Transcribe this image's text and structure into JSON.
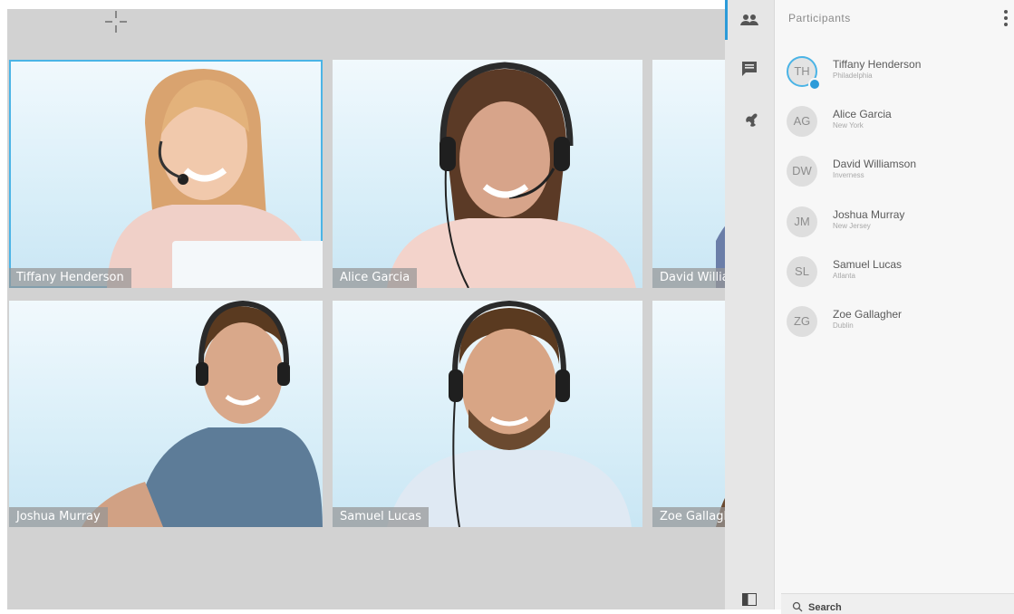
{
  "tiles": [
    {
      "name": "Tiffany Henderson",
      "active": true
    },
    {
      "name": "Alice Garcia"
    },
    {
      "name": "David Williamson"
    },
    {
      "name": "Joshua Murray"
    },
    {
      "name": "Samuel Lucas"
    },
    {
      "name": "Zoe Gallagher"
    }
  ],
  "panel": {
    "title": "Participants",
    "participants": [
      {
        "initials": "TH",
        "name": "Tiffany Henderson",
        "location": "Philadelphia"
      },
      {
        "initials": "AG",
        "name": "Alice Garcia",
        "location": "New York"
      },
      {
        "initials": "DW",
        "name": "David Williamson",
        "location": "Inverness"
      },
      {
        "initials": "JM",
        "name": "Joshua Murray",
        "location": "New Jersey"
      },
      {
        "initials": "SL",
        "name": "Samuel Lucas",
        "location": "Atlanta"
      },
      {
        "initials": "ZG",
        "name": "Zoe Gallagher",
        "location": "Dublin"
      }
    ],
    "search_label": "Search"
  },
  "rail": {
    "icons": [
      "people-icon",
      "chat-icon",
      "wrench-icon",
      "layout-icon"
    ]
  },
  "colors": {
    "accent": "#2c9bd9",
    "tile_highlight": "#4bb4e6"
  }
}
